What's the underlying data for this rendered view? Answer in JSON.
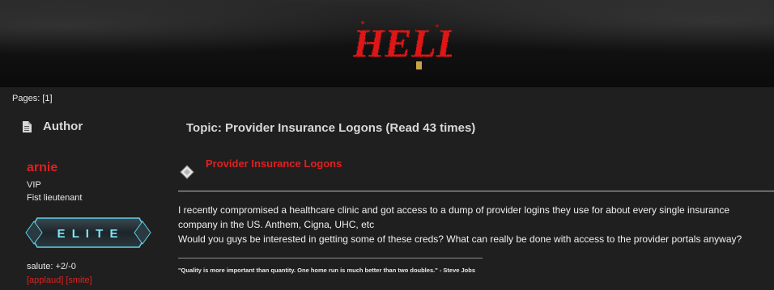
{
  "banner": {
    "logo_text": "HELL",
    "colors": {
      "logo_red": "#e01818",
      "background": "#1f1f1f"
    }
  },
  "navigation": {
    "pages_label": "Pages:",
    "pages_current": "[1]"
  },
  "author_column": {
    "header_label": "Author",
    "header_icon": "document-icon",
    "poster": {
      "name": "arnie",
      "member_group": "VIP",
      "rank": "Fist lieutenant",
      "badge_text": "E L I T E",
      "karma": "salute: +2/-0",
      "applaud_label": "[applaud]",
      "smite_label": "[smite]"
    }
  },
  "topic": {
    "header": "Topic: Provider Insurance Logons  (Read 43 times)",
    "post": {
      "icon": "post-icon",
      "title": "Provider Insurance Logons",
      "body_lines": [
        "I recently compromised a healthcare clinic and got access to a dump of provider logins they use for about every single insurance",
        "company in the US. Anthem, Cigna, UHC, etc",
        "Would you guys be interested in getting some of these creds? What can really be done with access to the provider portals anyway?"
      ],
      "signature": "\"Quality is more important than quantity. One home run is much better than two doubles.\" - Steve Jobs"
    }
  }
}
